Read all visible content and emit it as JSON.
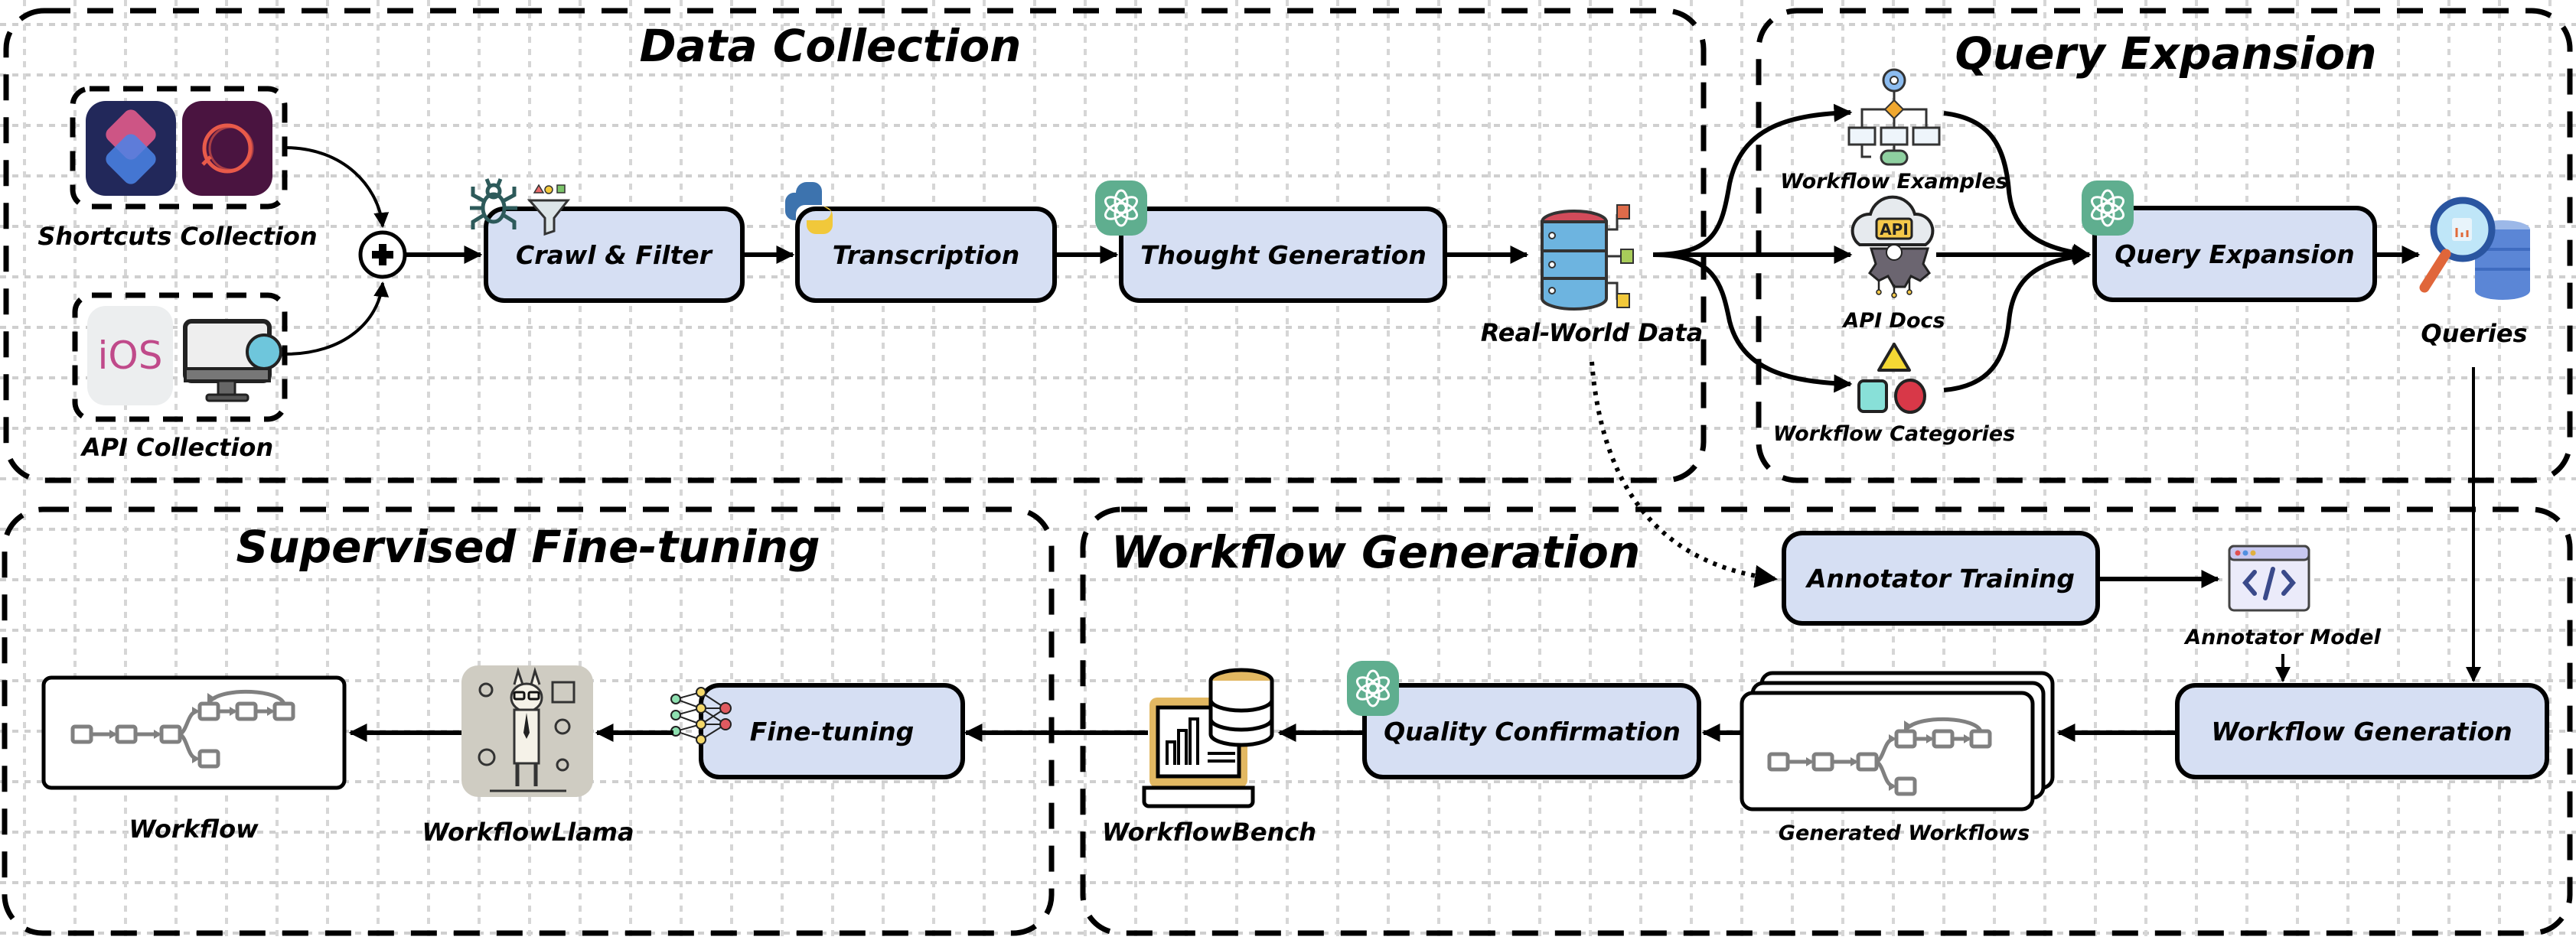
{
  "panels": {
    "data_collection": {
      "title": "Data Collection"
    },
    "query_expansion": {
      "title": "Query Expansion"
    },
    "supervised_finetuning": {
      "title": "Supervised Fine-tuning"
    },
    "workflow_generation": {
      "title": "Workflow Generation"
    }
  },
  "data_collection": {
    "shortcuts_label": "Shortcuts Collection",
    "api_label": "API Collection",
    "ios_text": "iOS",
    "steps": [
      {
        "label": "Crawl & Filter",
        "icons": [
          "spider-icon",
          "filter-funnel-icon"
        ]
      },
      {
        "label": "Transcription",
        "icons": [
          "python-icon"
        ]
      },
      {
        "label": "Thought Generation",
        "icons": [
          "chatgpt-icon"
        ]
      }
    ],
    "output_label": "Real-World Data"
  },
  "query_expansion": {
    "sources": [
      {
        "label": "Workflow Examples",
        "icon": "flowchart-icon"
      },
      {
        "label": "API Docs",
        "icon": "api-cloud-icon",
        "badge": "API"
      },
      {
        "label": "Workflow Categories",
        "icon": "shapes-icon"
      }
    ],
    "step_label": "Query Expansion",
    "output_label": "Queries"
  },
  "workflow_generation": {
    "annotator_training": "Annotator Training",
    "annotator_model": "Annotator Model",
    "generation_step": "Workflow Generation",
    "generated_label": "Generated Workflows",
    "quality_step": "Quality Confirmation",
    "bench_label": "WorkflowBench"
  },
  "supervised_finetuning": {
    "step_label": "Fine-tuning",
    "model_label": "WorkflowLlama",
    "output_label": "Workflow"
  },
  "colors": {
    "box_fill": "#d6dff3",
    "chatgpt_green": "#5fae8f",
    "grid": "#c8c8c8"
  }
}
